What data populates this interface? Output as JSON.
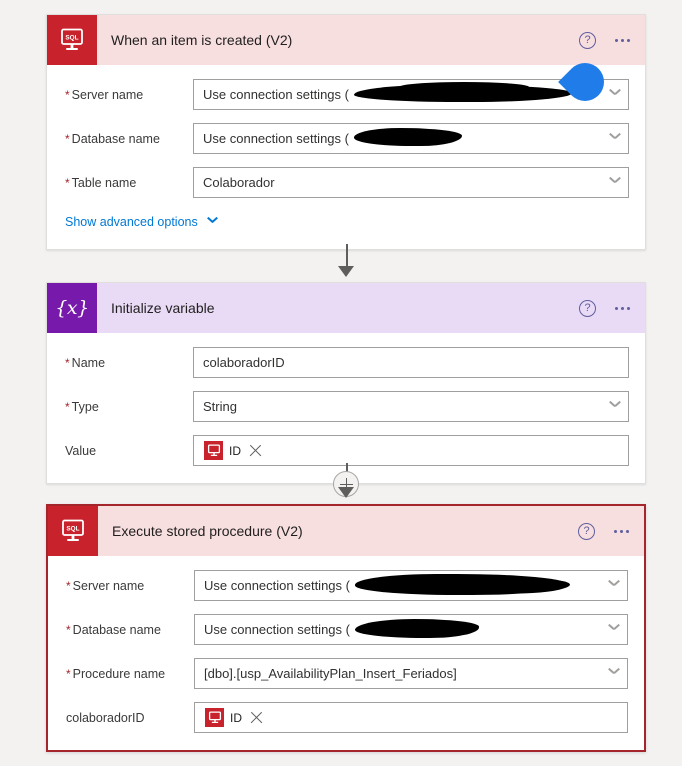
{
  "page": {
    "background_color": "#f3f2f1",
    "accent_link_color": "#0078d4",
    "error_border_color": "#a4262c",
    "sql_brand_color": "#c8232c",
    "variable_brand_color": "#7719aa",
    "droplet_color": "#1f7ce8"
  },
  "common": {
    "help_icon_label": "?",
    "more_commands_label": "···",
    "required_marker": "*",
    "token_icon_name": "sql-monitor-icon",
    "chevron_icon_name": "chevron-down-icon"
  },
  "cards": [
    {
      "id": "when-an-item-is-created",
      "title": "When an item is created (V2)",
      "icon": "sql-monitor-icon",
      "icon_text": "SQL",
      "state": "normal",
      "fields": [
        {
          "label": "Server name",
          "required": true,
          "value": "Use connection settings (",
          "redacted": true,
          "control": "dropdown"
        },
        {
          "label": "Database name",
          "required": true,
          "value": "Use connection settings (",
          "redacted": true,
          "control": "dropdown"
        },
        {
          "label": "Table name",
          "required": true,
          "value": "Colaborador",
          "redacted": false,
          "control": "dropdown"
        }
      ],
      "advanced_options_label": "Show advanced options"
    },
    {
      "id": "initialize-variable",
      "title": "Initialize variable",
      "icon": "variable-braces-icon",
      "icon_text": "{x}",
      "state": "normal",
      "fields": [
        {
          "label": "Name",
          "required": true,
          "value": "colaboradorID",
          "control": "text"
        },
        {
          "label": "Type",
          "required": true,
          "value": "String",
          "control": "dropdown"
        },
        {
          "label": "Value",
          "required": false,
          "value": "",
          "control": "token",
          "token": {
            "label": "ID",
            "icon": "sql-monitor-icon",
            "remove_label": "×"
          }
        }
      ]
    },
    {
      "id": "execute-stored-procedure",
      "title": "Execute stored procedure (V2)",
      "icon": "sql-monitor-icon",
      "icon_text": "SQL",
      "state": "error",
      "fields": [
        {
          "label": "Server name",
          "required": true,
          "value": "Use connection settings (",
          "redacted": true,
          "control": "dropdown"
        },
        {
          "label": "Database name",
          "required": true,
          "value": "Use connection settings (",
          "redacted": true,
          "control": "dropdown"
        },
        {
          "label": "Procedure name",
          "required": true,
          "value": "[dbo].[usp_AvailabilityPlan_Insert_Feriados]",
          "redacted": false,
          "control": "dropdown"
        },
        {
          "label": "colaboradorID",
          "required": false,
          "value": "",
          "control": "token",
          "token": {
            "label": "ID",
            "icon": "sql-monitor-icon",
            "remove_label": "×"
          }
        }
      ]
    }
  ],
  "connectors": [
    {
      "id": "connector-1",
      "type": "arrow",
      "insert_button": false
    },
    {
      "id": "connector-2",
      "type": "arrow",
      "insert_button": true,
      "insert_label": "+"
    }
  ]
}
